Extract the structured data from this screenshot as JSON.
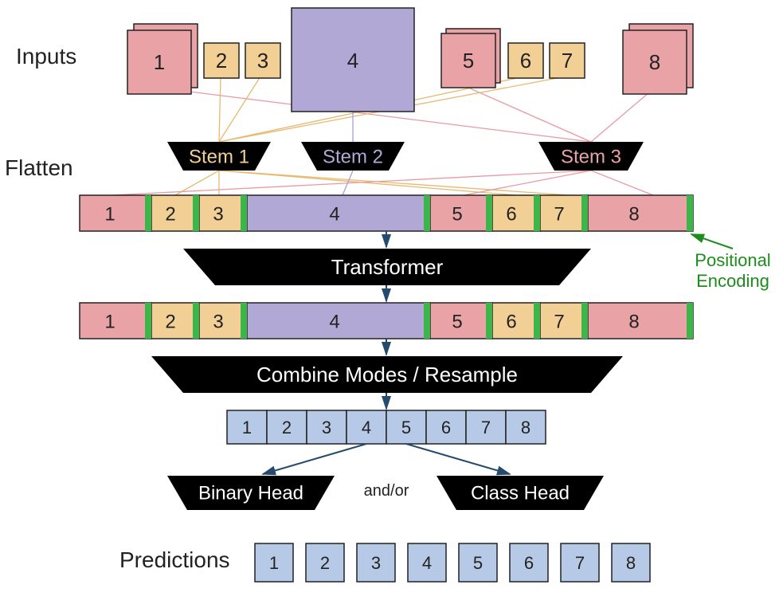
{
  "colors": {
    "pink": "#e9a3a7",
    "orange": "#f2cf95",
    "purple": "#b1a8d6",
    "blue": "#b6c9e6",
    "green": "#3eb54a",
    "black": "#000000",
    "stem3_text": "#e9a3a7"
  },
  "labels": {
    "inputs": "Inputs",
    "flatten": "Flatten",
    "stem1": "Stem 1",
    "stem2": "Stem 2",
    "stem3": "Stem 3",
    "transformer": "Transformer",
    "combine": "Combine Modes / Resample",
    "binary": "Binary Head",
    "andor": "and/or",
    "classhead": "Class Head",
    "predictions": "Predictions",
    "posenc1": "Positional",
    "posenc2": "Encoding"
  },
  "tokens": [
    "1",
    "2",
    "3",
    "4",
    "5",
    "6",
    "7",
    "8"
  ],
  "inputs": [
    {
      "num": "1",
      "color": "pink",
      "size": "L",
      "stack": true
    },
    {
      "num": "2",
      "color": "orange",
      "size": "S",
      "stack": false
    },
    {
      "num": "3",
      "color": "orange",
      "size": "S",
      "stack": false
    },
    {
      "num": "4",
      "color": "purple",
      "size": "XL",
      "stack": false
    },
    {
      "num": "5",
      "color": "pink",
      "size": "M",
      "stack": true
    },
    {
      "num": "6",
      "color": "orange",
      "size": "S",
      "stack": false
    },
    {
      "num": "7",
      "color": "orange",
      "size": "S",
      "stack": false
    },
    {
      "num": "8",
      "color": "pink",
      "size": "L",
      "stack": true
    }
  ],
  "seq_tokens": [
    {
      "num": "1",
      "color": "pink",
      "w": "L"
    },
    {
      "num": "2",
      "color": "orange",
      "w": "S"
    },
    {
      "num": "3",
      "color": "orange",
      "w": "S"
    },
    {
      "num": "4",
      "color": "purple",
      "w": "XL"
    },
    {
      "num": "5",
      "color": "pink",
      "w": "M"
    },
    {
      "num": "6",
      "color": "orange",
      "w": "S"
    },
    {
      "num": "7",
      "color": "orange",
      "w": "S"
    },
    {
      "num": "8",
      "color": "pink",
      "w": "M"
    }
  ]
}
